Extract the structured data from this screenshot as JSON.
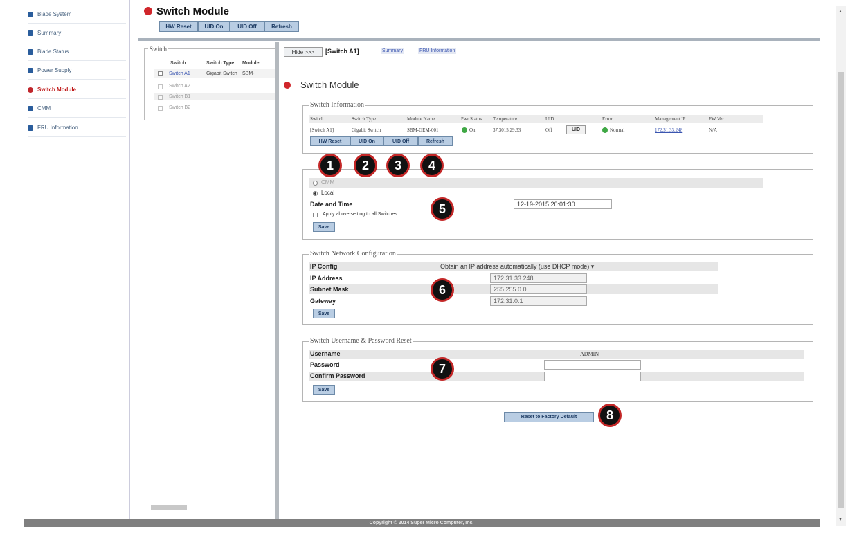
{
  "sidebar": {
    "items": [
      {
        "label": "Blade System"
      },
      {
        "label": "Summary"
      },
      {
        "label": "Blade Status"
      },
      {
        "label": "Power Supply"
      },
      {
        "label": "Switch Module"
      },
      {
        "label": "CMM"
      },
      {
        "label": "FRU Information"
      }
    ],
    "active_index": 4
  },
  "header": {
    "title": "Switch Module",
    "buttons": [
      "HW Reset",
      "UID On",
      "UID Off",
      "Refresh"
    ]
  },
  "switch_list": {
    "legend": "Switch",
    "headers": [
      "Switch",
      "Switch Type",
      "Module"
    ],
    "rows": [
      {
        "switch": "Switch A1",
        "type": "Gigabit Switch",
        "module": "SBM-",
        "checked": true
      },
      {
        "switch": "Switch A2",
        "type": "",
        "module": "",
        "checked": false
      },
      {
        "switch": "Switch B1",
        "type": "",
        "module": "",
        "checked": false
      },
      {
        "switch": "Switch B2",
        "type": "",
        "module": "",
        "checked": false
      }
    ]
  },
  "breadcrumb": {
    "hide_label": "Hide >>>",
    "current": "[Switch A1]",
    "links": [
      "Summary",
      "FRU Information"
    ]
  },
  "main": {
    "title": "Switch Module",
    "switch_info": {
      "legend": "Switch Information",
      "headers": [
        "Switch",
        "Switch Type",
        "Module Name",
        "Pwr Status",
        "Temperature",
        "UID",
        "Error",
        "Management IP",
        "FW Ver"
      ],
      "row": {
        "switch": "[Switch A1]",
        "type": "Gigabit Switch",
        "module": "SBM-GEM-001",
        "pwr": "On",
        "temperature": "37.3015 29.33",
        "uid": "Off",
        "uid_button": "UID",
        "error": "Normal",
        "ip": "172.31.33.248",
        "fw": "N/A"
      },
      "buttons": [
        "HW Reset",
        "UID On",
        "UID Off",
        "Refresh"
      ]
    },
    "clock": {
      "radio_cmm": "CMM",
      "radio_local": "Local",
      "date_label": "Date and Time",
      "date_value": "12-19-2015 20:01:30",
      "apply_label": "Apply above setting to all Switches",
      "save": "Save"
    },
    "network": {
      "legend": "Switch Network Configuration",
      "ip_config_label": "IP Config",
      "ip_config_value": "Obtain an IP address automatically (use DHCP mode) ▾",
      "ip_label": "IP Address",
      "ip_value": "172.31.33.248",
      "mask_label": "Subnet Mask",
      "mask_value": "255.255.0.0",
      "gateway_label": "Gateway",
      "gateway_value": "172.31.0.1",
      "save": "Save"
    },
    "credentials": {
      "legend": "Switch Username & Password Reset",
      "username_label": "Username",
      "username_value": "ADMIN",
      "password_label": "Password",
      "confirm_label": "Confirm Password",
      "save": "Save"
    },
    "factory_reset": "Reset to Factory Default"
  },
  "callouts": [
    "1",
    "2",
    "3",
    "4",
    "5",
    "6",
    "7",
    "8"
  ],
  "footer": "Copyright © 2014 Super Micro Computer, Inc.",
  "colors": {
    "accent_red": "#d0262b",
    "button_fill": "#b9cde3",
    "badge_ring": "#c32727"
  }
}
